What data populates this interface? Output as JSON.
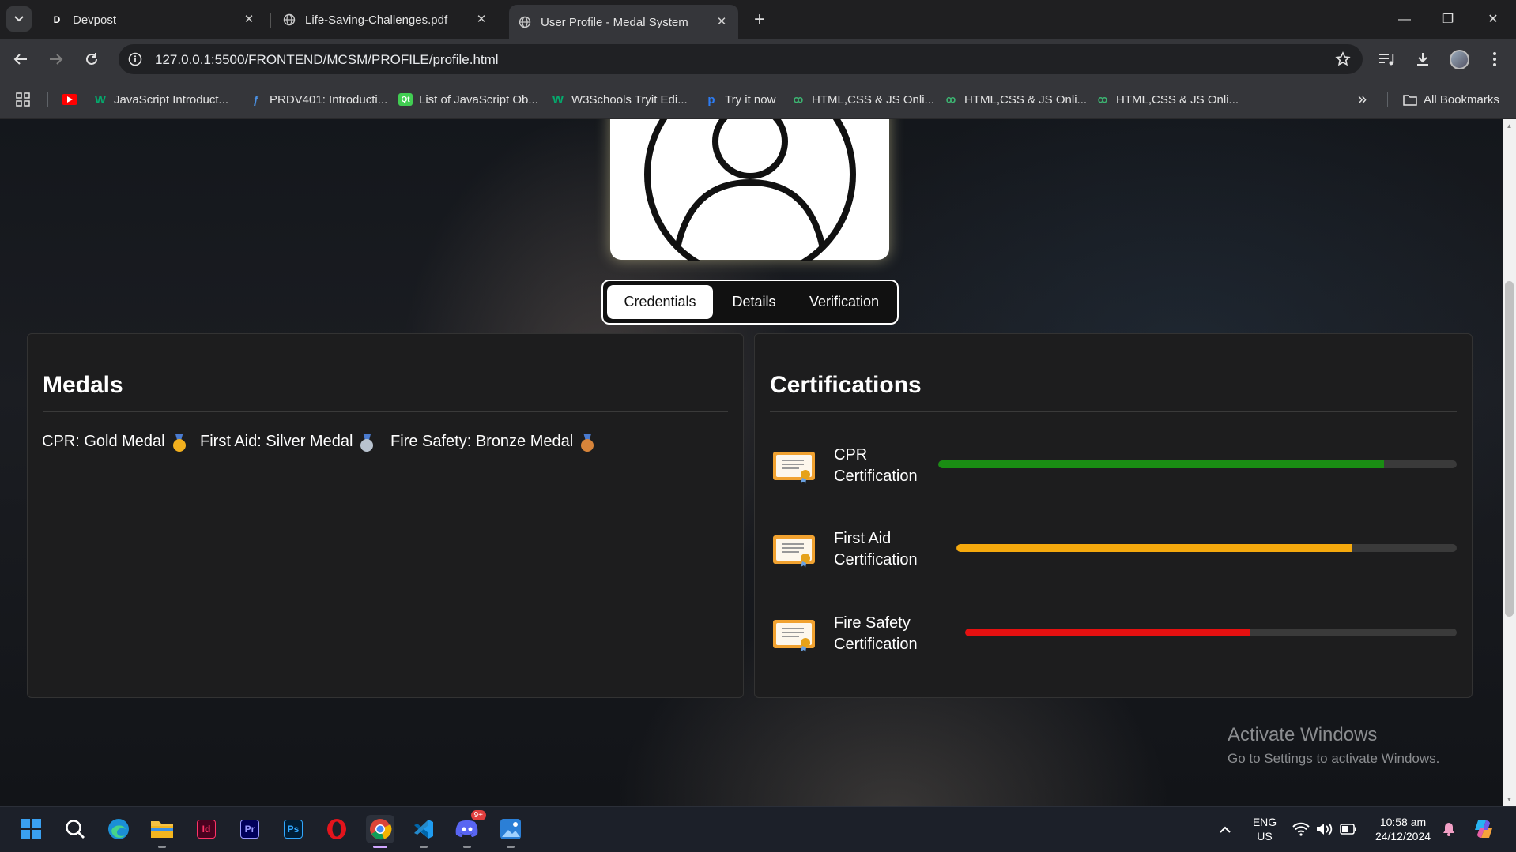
{
  "browser": {
    "tabs": [
      {
        "title": "Devpost",
        "favicon": "D"
      },
      {
        "title": "Life-Saving-Challenges.pdf",
        "favicon": "globe-icon"
      },
      {
        "title": "User Profile - Medal System",
        "favicon": "globe-icon",
        "active": true
      }
    ],
    "url": "127.0.0.1:5500/FRONTEND/MCSM/PROFILE/profile.html",
    "bookmarks": [
      {
        "label": "",
        "icon": "youtube-icon"
      },
      {
        "label": "JavaScript Introduct...",
        "icon": "w3schools-icon"
      },
      {
        "label": "PRDV401: Introducti...",
        "icon": "saylor-icon"
      },
      {
        "label": "List of JavaScript Ob...",
        "icon": "qt-icon"
      },
      {
        "label": "W3Schools Tryit Edi...",
        "icon": "w3schools-icon"
      },
      {
        "label": "Try it now",
        "icon": "p-icon"
      },
      {
        "label": "HTML,CSS & JS Onli...",
        "icon": "gg-icon"
      },
      {
        "label": "HTML,CSS & JS Onli...",
        "icon": "gg-icon"
      },
      {
        "label": "HTML,CSS & JS Onli...",
        "icon": "gg-icon"
      }
    ],
    "all_bookmarks": "All Bookmarks"
  },
  "page": {
    "tabs": [
      {
        "label": "Credentials",
        "active": true
      },
      {
        "label": "Details",
        "active": false
      },
      {
        "label": "Verification",
        "active": false
      }
    ],
    "medals": {
      "title": "Medals",
      "items": [
        {
          "label": "CPR: Gold Medal",
          "color": "#f2b01e"
        },
        {
          "label": "First Aid: Silver Medal",
          "color": "#b9c3cf"
        },
        {
          "label": "Fire Safety: Bronze Medal",
          "color": "#d7843a"
        }
      ]
    },
    "certifications": {
      "title": "Certifications",
      "items": [
        {
          "line1": "CPR",
          "line2": "Certification",
          "progress": 0.86,
          "color": "#1a8d13"
        },
        {
          "line1": "First Aid",
          "line2": "Certification",
          "progress": 0.79,
          "color": "#f5a90d"
        },
        {
          "line1": "Fire Safety",
          "line2": "Certification",
          "progress": 0.58,
          "color": "#e51010"
        }
      ]
    }
  },
  "watermark": {
    "line1": "Activate Windows",
    "line2": "Go to Settings to activate Windows."
  },
  "taskbar": {
    "apps": [
      "windows-start-icon",
      "search-icon",
      "edge-icon",
      "file-explorer-icon",
      "indesign-icon",
      "premiere-icon",
      "photoshop-icon",
      "opera-icon",
      "chrome-icon",
      "vscode-icon",
      "discord-icon",
      "photos-icon"
    ],
    "indesign": "Id",
    "premiere": "Pr",
    "photoshop": "Ps",
    "discord_badge": "9+",
    "lang1": "ENG",
    "lang2": "US",
    "time": "10:58 am",
    "date": "24/12/2024"
  }
}
